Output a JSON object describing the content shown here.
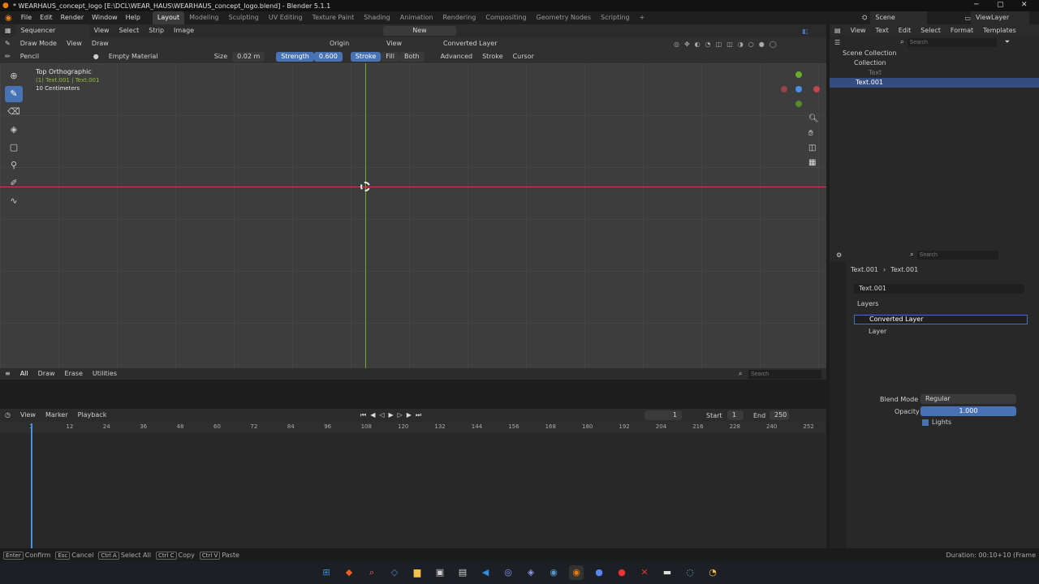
{
  "titlebar": {
    "title": "* WEARHAUS_concept_logo [E:\\DCL\\WEAR_HAUS\\WEARHAUS_concept_logo.blend] - Blender 5.1.1"
  },
  "menubar": {
    "menus": [
      "File",
      "Edit",
      "Render",
      "Window",
      "Help"
    ],
    "workspaces": [
      "Layout",
      "Modeling",
      "Sculpting",
      "UV Editing",
      "Texture Paint",
      "Shading",
      "Animation",
      "Rendering",
      "Compositing",
      "Geometry Nodes",
      "Scripting"
    ],
    "active_workspace": "Layout",
    "scene": "Scene",
    "view_layer": "ViewLayer"
  },
  "editor_header": {
    "editor": "Sequencer",
    "menus": [
      "View",
      "Select",
      "Strip",
      "Image"
    ],
    "new_label": "New"
  },
  "viewport_header": {
    "mode": "Draw Mode",
    "menus": [
      "View",
      "Draw"
    ],
    "origin": "Origin",
    "view": "View",
    "layer": "Converted Layer"
  },
  "tool_settings": {
    "brush": "Pencil",
    "material": "Empty Material",
    "size_label": "Size",
    "size_value": "0.02 m",
    "strength_label": "Strength",
    "strength_value": "0.600",
    "stroke": "Stroke",
    "fill": "Fill",
    "both": "Both",
    "advanced": "Advanced",
    "stroke_menu": "Stroke",
    "cursor": "Cursor"
  },
  "viewport": {
    "view_name": "Top Orthographic",
    "object_info": "(1) Text.001 | Text.001",
    "scale": "10 Centimeters"
  },
  "asset_shelf": {
    "tabs": [
      "All",
      "Draw",
      "Erase",
      "Utilities"
    ],
    "active_tab": "All",
    "search_placeholder": "Search"
  },
  "timeline": {
    "menus": [
      "View",
      "Marker",
      "Playback"
    ],
    "current_frame": "1",
    "start_label": "Start",
    "start_value": "1",
    "end_label": "End",
    "end_value": "250",
    "ticks": [
      "1",
      "12",
      "24",
      "36",
      "48",
      "60",
      "72",
      "84",
      "96",
      "108",
      "120",
      "132",
      "144",
      "156",
      "168",
      "180",
      "192",
      "204",
      "216",
      "228",
      "240",
      "252"
    ]
  },
  "outliner": {
    "menus": [
      "View",
      "Text",
      "Edit",
      "Select",
      "Format",
      "Templates"
    ],
    "search_placeholder": "Search",
    "scene_collection": "Scene Collection",
    "items": [
      {
        "label": "Collection"
      },
      {
        "label": "Text"
      },
      {
        "label": "Text.001"
      }
    ]
  },
  "properties": {
    "search_placeholder": "Search",
    "breadcrumb": [
      "Text.001",
      "Text.001"
    ],
    "data_name": "Text.001",
    "layers_panel": "Layers",
    "layers": [
      "Converted Layer",
      "Layer"
    ],
    "blend_mode_label": "Blend Mode",
    "blend_mode_value": "Regular",
    "opacity_label": "Opacity",
    "opacity_value": "1.000",
    "lights_label": "Lights"
  },
  "statusbar": {
    "hints": [
      {
        "key": "Enter",
        "label": "Confirm"
      },
      {
        "key": "Esc",
        "label": "Cancel"
      },
      {
        "key": "Ctrl A",
        "label": "Select All"
      },
      {
        "key": "Ctrl C",
        "label": "Copy"
      },
      {
        "key": "Ctrl V",
        "label": "Paste"
      }
    ],
    "duration": "Duration: 00:10+10 (Frame"
  },
  "colors": {
    "accent": "#4772b3",
    "x_axis": "#c0454f",
    "y_axis": "#6bab2c",
    "playhead": "#4a90e2"
  }
}
